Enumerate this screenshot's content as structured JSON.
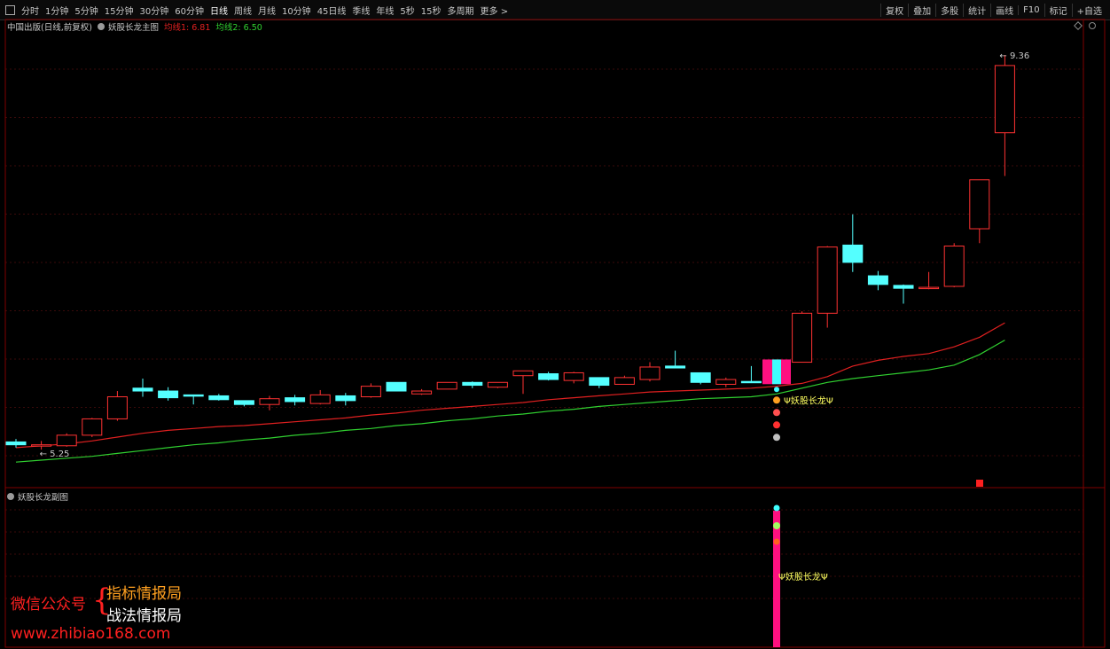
{
  "toolbar": {
    "periods": [
      "分时",
      "1分钟",
      "5分钟",
      "15分钟",
      "30分钟",
      "60分钟",
      "日线",
      "周线",
      "月线",
      "10分钟",
      "45日线",
      "季线",
      "年线",
      "5秒",
      "15秒",
      "多周期",
      "更多 >"
    ],
    "active_period": "日线",
    "right_buttons": [
      "复权",
      "叠加",
      "多股",
      "统计",
      "画线",
      "F10",
      "标记",
      "+自选"
    ]
  },
  "legend": {
    "stock": "中国出版(日线,前复权)",
    "indicator": "妖股长龙主图",
    "ma1": "均线1: 6.81",
    "ma2": "均线2: 6.50"
  },
  "sub_legend": {
    "indicator": "妖股长龙副图"
  },
  "colors": {
    "up": "#ff3232",
    "down": "#54ffff",
    "ma1": "#e02020",
    "ma2": "#30d030",
    "signal_magenta": "#ff1080",
    "signal_cyan": "#40ffff",
    "label_yellow": "#ffff60",
    "grid": "#3a0a0a",
    "divider": "#800000"
  },
  "chart_data": {
    "type": "candlestick",
    "x_unit": "trading day index",
    "ylim": [
      4.9,
      9.6
    ],
    "candles": [
      {
        "x": 0,
        "o": 5.33,
        "h": 5.36,
        "l": 5.27,
        "c": 5.3
      },
      {
        "x": 1,
        "o": 5.3,
        "h": 5.34,
        "l": 5.25,
        "c": 5.3
      },
      {
        "x": 2,
        "o": 5.29,
        "h": 5.42,
        "l": 5.28,
        "c": 5.4
      },
      {
        "x": 3,
        "o": 5.4,
        "h": 5.58,
        "l": 5.38,
        "c": 5.57
      },
      {
        "x": 4,
        "o": 5.57,
        "h": 5.86,
        "l": 5.55,
        "c": 5.8
      },
      {
        "x": 5,
        "o": 5.89,
        "h": 5.99,
        "l": 5.8,
        "c": 5.86
      },
      {
        "x": 6,
        "o": 5.86,
        "h": 5.9,
        "l": 5.76,
        "c": 5.79
      },
      {
        "x": 7,
        "o": 5.82,
        "h": 5.82,
        "l": 5.72,
        "c": 5.81
      },
      {
        "x": 8,
        "o": 5.81,
        "h": 5.83,
        "l": 5.76,
        "c": 5.77
      },
      {
        "x": 9,
        "o": 5.76,
        "h": 5.76,
        "l": 5.7,
        "c": 5.72
      },
      {
        "x": 10,
        "o": 5.72,
        "h": 5.81,
        "l": 5.66,
        "c": 5.78
      },
      {
        "x": 11,
        "o": 5.79,
        "h": 5.82,
        "l": 5.71,
        "c": 5.75
      },
      {
        "x": 12,
        "o": 5.73,
        "h": 5.87,
        "l": 5.72,
        "c": 5.82
      },
      {
        "x": 13,
        "o": 5.81,
        "h": 5.84,
        "l": 5.71,
        "c": 5.76
      },
      {
        "x": 14,
        "o": 5.8,
        "h": 5.94,
        "l": 5.79,
        "c": 5.91
      },
      {
        "x": 15,
        "o": 5.95,
        "h": 5.95,
        "l": 5.86,
        "c": 5.86
      },
      {
        "x": 16,
        "o": 5.83,
        "h": 5.88,
        "l": 5.82,
        "c": 5.86
      },
      {
        "x": 17,
        "o": 5.88,
        "h": 5.95,
        "l": 5.88,
        "c": 5.95
      },
      {
        "x": 18,
        "o": 5.95,
        "h": 5.96,
        "l": 5.89,
        "c": 5.92
      },
      {
        "x": 19,
        "o": 5.9,
        "h": 5.95,
        "l": 5.89,
        "c": 5.95
      },
      {
        "x": 20,
        "o": 6.02,
        "h": 6.06,
        "l": 5.83,
        "c": 6.07
      },
      {
        "x": 21,
        "o": 6.04,
        "h": 6.06,
        "l": 5.97,
        "c": 5.98
      },
      {
        "x": 22,
        "o": 5.97,
        "h": 6.06,
        "l": 5.94,
        "c": 6.05
      },
      {
        "x": 23,
        "o": 6.0,
        "h": 6.0,
        "l": 5.89,
        "c": 5.92
      },
      {
        "x": 24,
        "o": 5.93,
        "h": 6.02,
        "l": 5.93,
        "c": 6.0
      },
      {
        "x": 25,
        "o": 5.98,
        "h": 6.16,
        "l": 5.96,
        "c": 6.11
      },
      {
        "x": 26,
        "o": 6.12,
        "h": 6.28,
        "l": 6.1,
        "c": 6.1
      },
      {
        "x": 27,
        "o": 6.05,
        "h": 6.05,
        "l": 5.93,
        "c": 5.95
      },
      {
        "x": 28,
        "o": 5.93,
        "h": 6.0,
        "l": 5.9,
        "c": 5.98
      },
      {
        "x": 29,
        "o": 5.96,
        "h": 6.12,
        "l": 5.96,
        "c": 5.95
      },
      {
        "x": 30,
        "o": 5.95,
        "h": 6.17,
        "l": 5.95,
        "c": 6.16
      },
      {
        "x": 31,
        "o": 6.16,
        "h": 6.69,
        "l": 6.16,
        "c": 6.67
      },
      {
        "x": 32,
        "o": 6.67,
        "h": 7.37,
        "l": 6.52,
        "c": 7.36
      },
      {
        "x": 33,
        "o": 7.38,
        "h": 7.7,
        "l": 7.1,
        "c": 7.2
      },
      {
        "x": 34,
        "o": 7.06,
        "h": 7.11,
        "l": 6.91,
        "c": 6.97
      },
      {
        "x": 35,
        "o": 6.96,
        "h": 6.97,
        "l": 6.77,
        "c": 6.93
      },
      {
        "x": 36,
        "o": 6.93,
        "h": 7.1,
        "l": 6.92,
        "c": 6.94
      },
      {
        "x": 37,
        "o": 6.95,
        "h": 7.4,
        "l": 6.94,
        "c": 7.37
      },
      {
        "x": 38,
        "o": 7.55,
        "h": 8.06,
        "l": 7.4,
        "c": 8.06
      },
      {
        "x": 39,
        "o": 8.55,
        "h": 9.36,
        "l": 8.1,
        "c": 9.25
      }
    ],
    "ma1": [
      5.27,
      5.29,
      5.31,
      5.34,
      5.38,
      5.42,
      5.45,
      5.47,
      5.49,
      5.5,
      5.52,
      5.54,
      5.56,
      5.58,
      5.61,
      5.63,
      5.66,
      5.68,
      5.7,
      5.72,
      5.74,
      5.77,
      5.79,
      5.81,
      5.83,
      5.85,
      5.86,
      5.87,
      5.88,
      5.89,
      5.91,
      5.94,
      6.01,
      6.12,
      6.18,
      6.22,
      6.25,
      6.32,
      6.42,
      6.57
    ],
    "ma2": [
      5.12,
      5.14,
      5.16,
      5.18,
      5.21,
      5.24,
      5.27,
      5.3,
      5.32,
      5.35,
      5.37,
      5.4,
      5.42,
      5.45,
      5.47,
      5.5,
      5.52,
      5.55,
      5.57,
      5.6,
      5.62,
      5.65,
      5.67,
      5.7,
      5.72,
      5.74,
      5.76,
      5.78,
      5.79,
      5.8,
      5.83,
      5.89,
      5.95,
      5.99,
      6.02,
      6.05,
      6.08,
      6.13,
      6.24,
      6.39
    ],
    "min_marker": {
      "x": 1,
      "label": "← 5.25"
    },
    "max_marker": {
      "x": 39,
      "label": "← 9.36"
    },
    "signal": {
      "x": 30,
      "label": "Ψ妖股长龙Ψ",
      "sub_label": "Ψ妖股长龙Ψ"
    },
    "sub_value": 1
  }
}
